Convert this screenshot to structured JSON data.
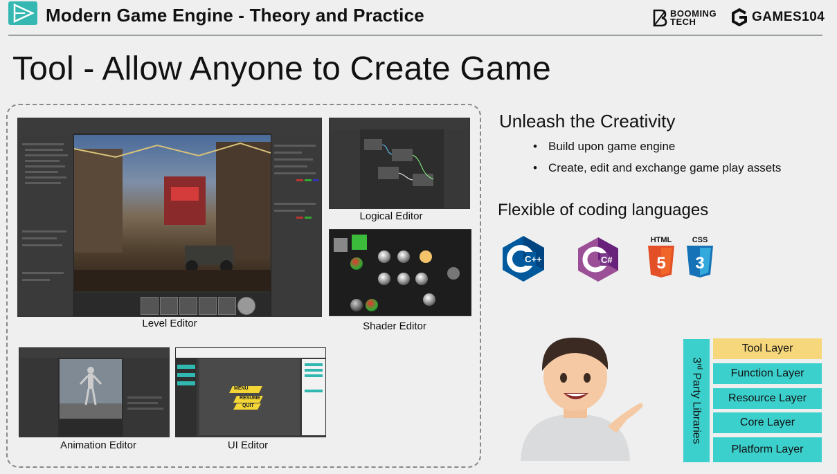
{
  "header": {
    "title": "Modern Game Engine - Theory and Practice",
    "booming_line1": "BOOMING",
    "booming_line2": "TECH",
    "games_label": "GAMES104"
  },
  "slide_title": "Tool - Allow Anyone to Create Game",
  "panels": {
    "level_editor": "Level Editor",
    "logical_editor": "Logical Editor",
    "shader_editor": "Shader Editor",
    "animation_editor": "Animation Editor",
    "ui_editor": "UI Editor"
  },
  "ui_editor_buttons": [
    "MENU",
    "RESUME",
    "QUIT"
  ],
  "right": {
    "section1_title": "Unleash the Creativity",
    "bullets": [
      "Build upon game engine",
      "Create, edit and exchange game play assets"
    ],
    "section2_title": "Flexible of coding languages",
    "languages": [
      {
        "name": "C++",
        "icon": "cpp-logo-icon",
        "color": "#00599c"
      },
      {
        "name": "C#",
        "icon": "csharp-logo-icon",
        "color": "#68217a"
      },
      {
        "name": "HTML",
        "icon": "html5-logo-icon",
        "color": "#e34f26"
      },
      {
        "name": "CSS",
        "icon": "css3-logo-icon",
        "color": "#1572b6"
      }
    ]
  },
  "layers": {
    "side_label_sup": "rd",
    "side_label_pre": "3",
    "side_label_post": " Party Libraries",
    "items": [
      {
        "label": "Tool Layer",
        "color": "#f7d77b"
      },
      {
        "label": "Function Layer",
        "color": "#3cd0cd"
      },
      {
        "label": "Resource Layer",
        "color": "#3cd0cd"
      },
      {
        "label": "Core Layer",
        "color": "#3cd0cd"
      },
      {
        "label": "Platform Layer",
        "color": "#3cd0cd"
      }
    ]
  },
  "colors": {
    "accent": "#35b8b2",
    "layer_cyan": "#3cd0cd",
    "layer_highlight": "#f7d77b"
  }
}
